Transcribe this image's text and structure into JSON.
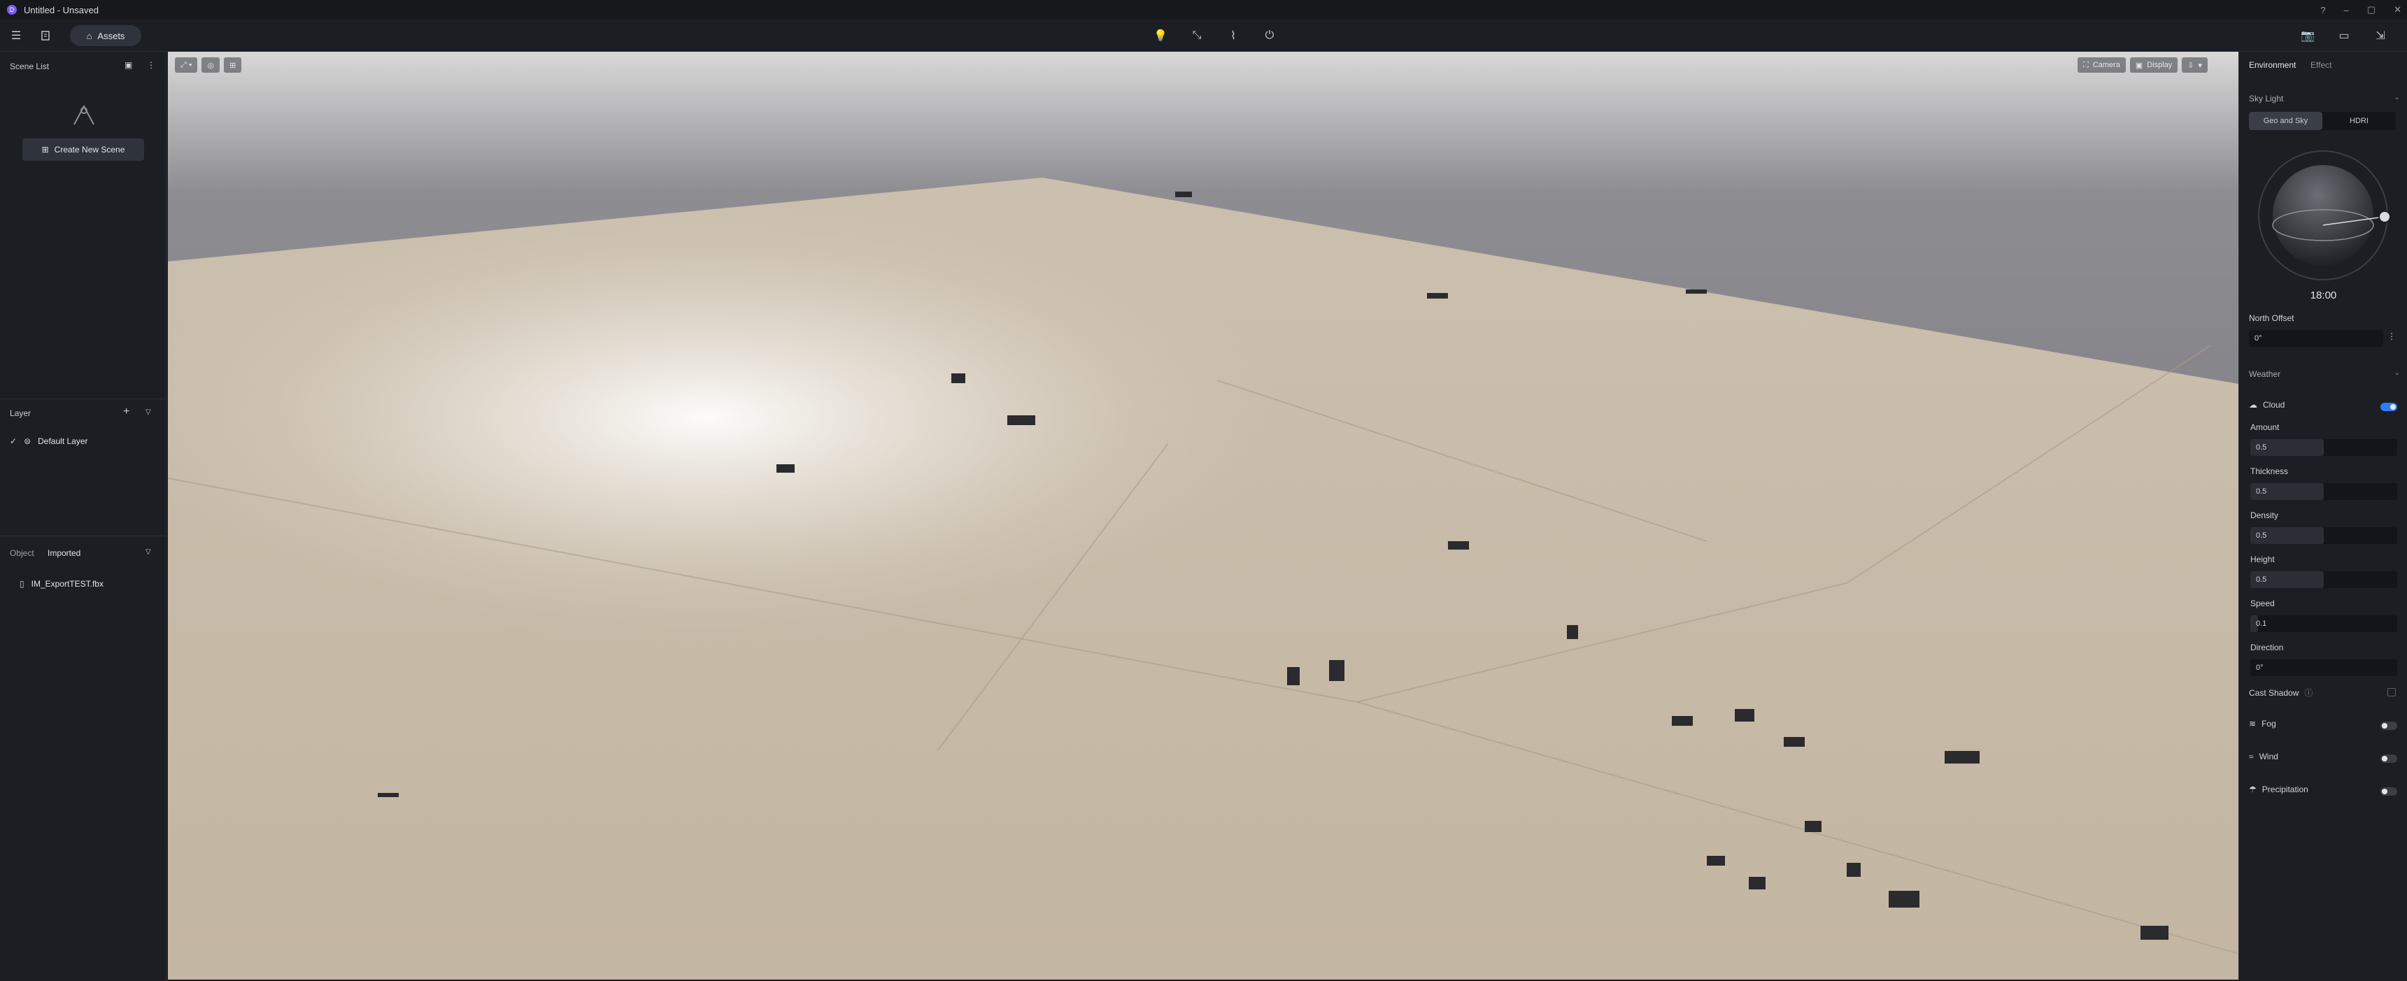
{
  "titlebar": {
    "title": "Untitled - Unsaved",
    "app_glyph": "D"
  },
  "toolbar": {
    "assets_label": "Assets",
    "icons": [
      "menu-icon",
      "document-icon",
      "lightbulb-icon",
      "path-icon",
      "leaf-icon",
      "power-icon",
      "camera-icon",
      "video-icon",
      "export-icon"
    ]
  },
  "scene_list": {
    "title": "Scene List",
    "create_label": "Create New Scene"
  },
  "layer": {
    "title": "Layer",
    "items": [
      {
        "label": "Default Layer",
        "checked": true
      }
    ]
  },
  "object": {
    "tab_object": "Object",
    "tab_imported": "Imported",
    "files": [
      "IM_ExportTEST.fbx"
    ]
  },
  "viewport": {
    "camera_label": "Camera",
    "display_label": "Display"
  },
  "right_panel": {
    "tabs": [
      "Environment",
      "Effect"
    ],
    "sky_light": "Sky Light",
    "sky_modes": [
      "Geo and Sky",
      "HDRI"
    ],
    "time": "18:00",
    "north_offset_label": "North Offset",
    "north_offset_value": "0°",
    "weather": "Weather",
    "cloud_label": "Cloud",
    "cloud_on": true,
    "fields": [
      {
        "label": "Amount",
        "value": "0.5",
        "level": 0.5
      },
      {
        "label": "Thickness",
        "value": "0.5",
        "level": 0.5
      },
      {
        "label": "Density",
        "value": "0.5",
        "level": 0.5
      },
      {
        "label": "Height",
        "value": "0.5",
        "level": 0.5
      },
      {
        "label": "Speed",
        "value": "0.1",
        "level": 0.05
      },
      {
        "label": "Direction",
        "value": "0°",
        "level": 0
      }
    ],
    "cast_shadow": "Cast Shadow",
    "fog": "Fog",
    "wind": "Wind",
    "precipitation": "Precipitation"
  }
}
